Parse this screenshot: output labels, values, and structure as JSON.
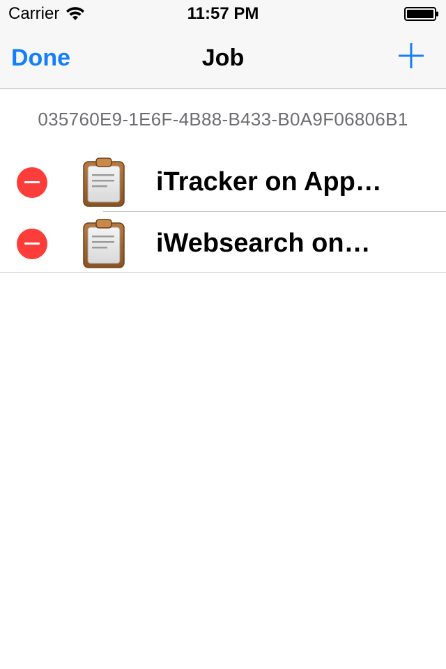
{
  "status_bar": {
    "carrier": "Carrier",
    "time": "11:57 PM",
    "wifi_icon": "wifi-icon",
    "battery_icon": "battery-icon"
  },
  "nav": {
    "done_label": "Done",
    "title": "Job",
    "add_icon": "plus-icon",
    "accent_color": "#147efb"
  },
  "device_id": "035760E9-1E6F-4B88-B433-B0A9F06806B1",
  "jobs": [
    {
      "label": "iTracker on App…",
      "icon": "clipboard-icon"
    },
    {
      "label": "iWebsearch on…",
      "icon": "clipboard-icon"
    }
  ],
  "colors": {
    "delete": "#fc3d39",
    "separator": "#c8c7cc",
    "nav_background": "#f7f7f7"
  }
}
